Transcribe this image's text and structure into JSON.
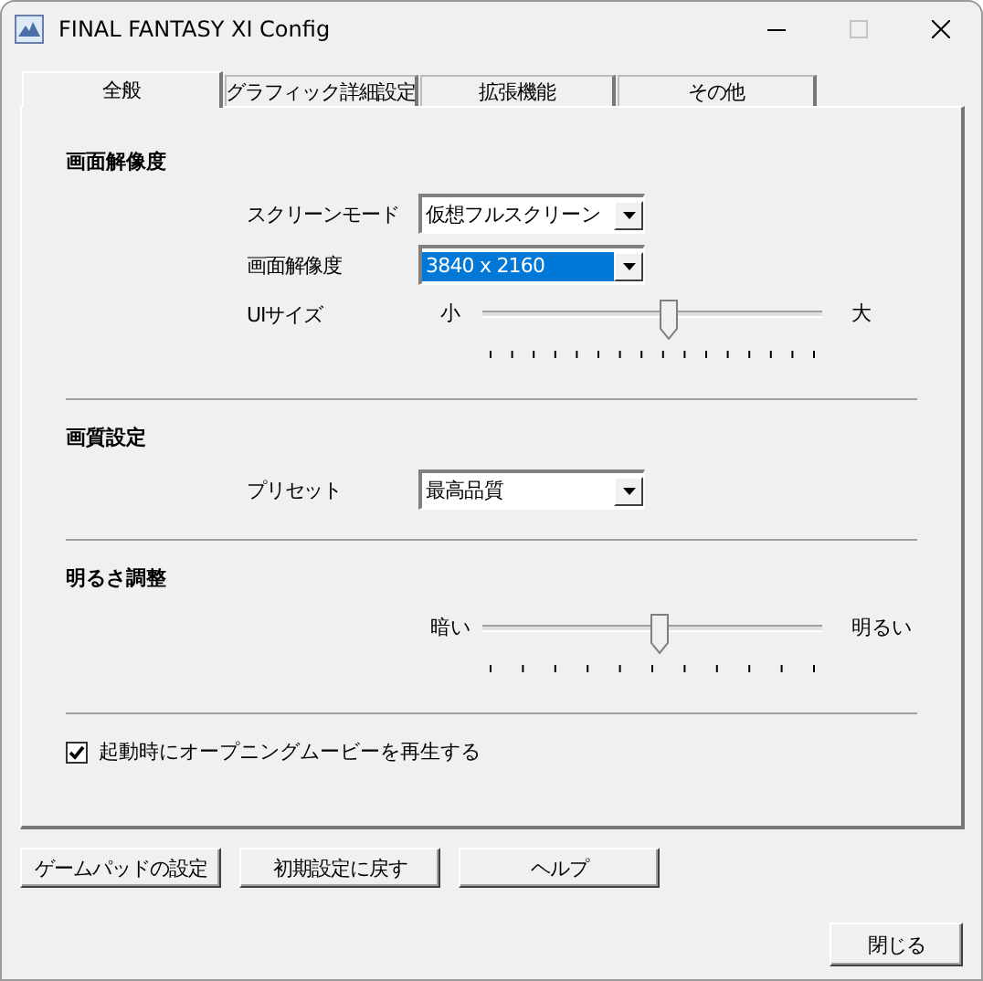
{
  "window": {
    "title": "FINAL FANTASY XI Config"
  },
  "tabs": [
    {
      "label": "全般",
      "selected": true
    },
    {
      "label": "グラフィック詳細設定",
      "selected": false
    },
    {
      "label": "拡張機能",
      "selected": false
    },
    {
      "label": "その他",
      "selected": false
    }
  ],
  "sections": [
    {
      "heading": "画面解像度",
      "rows": [
        {
          "kind": "select",
          "label": "スクリーンモード",
          "value": "仮想フルスクリーン",
          "highlighted": false
        },
        {
          "kind": "select",
          "label": "画面解像度",
          "value": "3840 x 2160",
          "highlighted": true
        },
        {
          "kind": "slider",
          "label": "UIサイズ",
          "min_label": "小",
          "max_label": "大",
          "level": 0.55
        }
      ]
    },
    {
      "heading": "画質設定",
      "rows": [
        {
          "kind": "select",
          "label": "プリセット",
          "value": "最高品質",
          "highlighted": false
        }
      ]
    },
    {
      "heading": "明るさ調整",
      "rows": [
        {
          "kind": "slider",
          "min_label": "暗い",
          "max_label": "明るい",
          "level": 0.52
        }
      ]
    }
  ],
  "checkbox": {
    "label": "起動時にオープニングムービーを再生する",
    "checked": true
  },
  "buttons": [
    "ゲームパッドの設定",
    "初期設定に戻す",
    "ヘルプ"
  ],
  "close_button": "閉じる"
}
